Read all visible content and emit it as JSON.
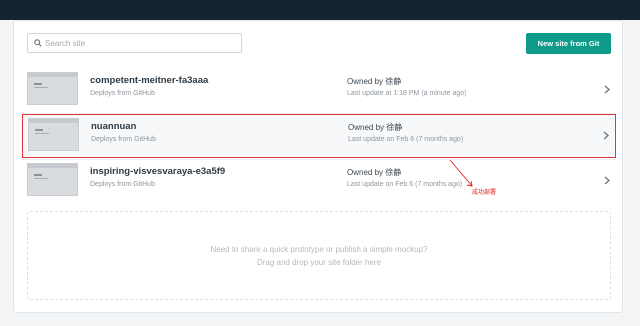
{
  "search": {
    "placeholder": "Search site"
  },
  "toolbar": {
    "new_site_label": "New site from Git"
  },
  "sites": [
    {
      "name": "competent-meitner-fa3aaa",
      "deploy_source": "Deploys from GitHub",
      "owner": "Owned by 徐静",
      "last_update": "Last update at 1:18 PM (a minute ago)"
    },
    {
      "name": "nuannuan",
      "deploy_source": "Deploys from GitHub",
      "owner": "Owned by 徐静",
      "last_update": "Last update on Feb 6 (7 months ago)"
    },
    {
      "name": "inspiring-visvesvaraya-e3a5f9",
      "deploy_source": "Deploys from GitHub",
      "owner": "Owned by 徐静",
      "last_update": "Last update on Feb 6 (7 months ago)"
    }
  ],
  "dropzone": {
    "line1": "Need to share a quick prototype or publish a simple mockup?",
    "line2": "Drag and drop your site folder here"
  },
  "annotation": {
    "text": "成功部署"
  },
  "colors": {
    "accent": "#0e9b8a",
    "header": "#152432",
    "highlight": "#e2333a"
  }
}
